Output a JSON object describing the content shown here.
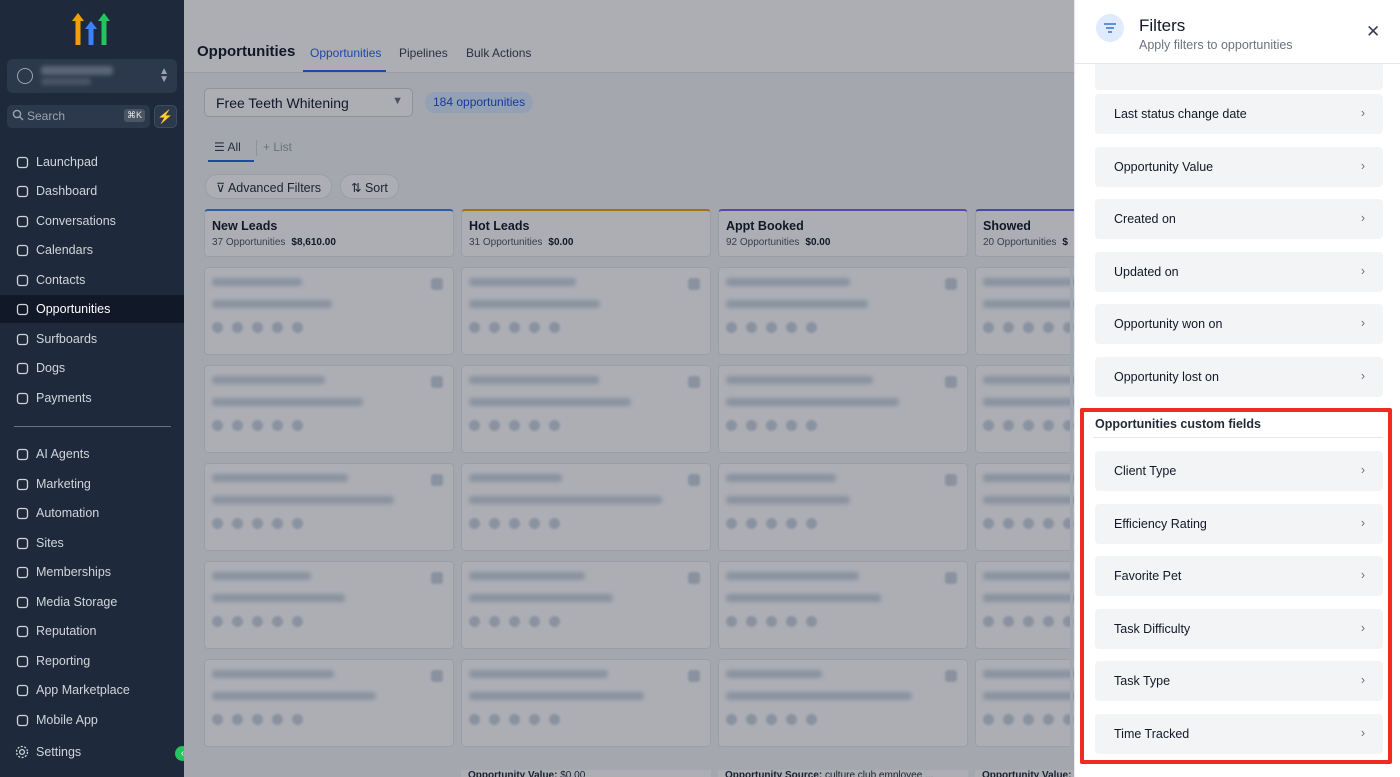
{
  "sidebar": {
    "search_placeholder": "Search",
    "search_shortcut": "⌘K",
    "items": [
      {
        "label": "Launchpad",
        "icon": "rocket-icon"
      },
      {
        "label": "Dashboard",
        "icon": "grid-icon"
      },
      {
        "label": "Conversations",
        "icon": "chat-bubble-icon"
      },
      {
        "label": "Calendars",
        "icon": "calendar-icon"
      },
      {
        "label": "Contacts",
        "icon": "contact-card-icon"
      },
      {
        "label": "Opportunities",
        "icon": "pipeline-icon",
        "active": true
      },
      {
        "label": "Surfboards",
        "icon": "surfboard-icon"
      },
      {
        "label": "Dogs",
        "icon": "paw-icon"
      },
      {
        "label": "Payments",
        "icon": "receipt-icon"
      },
      {
        "label": "AI Agents",
        "icon": "sparkle-icon"
      },
      {
        "label": "Marketing",
        "icon": "send-icon"
      },
      {
        "label": "Automation",
        "icon": "automation-icon"
      },
      {
        "label": "Sites",
        "icon": "sites-icon"
      },
      {
        "label": "Memberships",
        "icon": "membership-icon"
      },
      {
        "label": "Media Storage",
        "icon": "image-icon"
      },
      {
        "label": "Reputation",
        "icon": "star-icon"
      },
      {
        "label": "Reporting",
        "icon": "trend-icon"
      },
      {
        "label": "App Marketplace",
        "icon": "apps-icon"
      },
      {
        "label": "Mobile App",
        "icon": "mobile-icon"
      }
    ],
    "settings_label": "Settings"
  },
  "header": {
    "title": "Opportunities",
    "tabs": [
      "Opportunities",
      "Pipelines",
      "Bulk Actions"
    ],
    "active_tab": "Opportunities"
  },
  "toolbar": {
    "pipeline": "Free Teeth Whitening",
    "count": "184 opportunities",
    "view_all": "All",
    "view_list": "List",
    "advanced_filters": "Advanced Filters",
    "sort": "Sort"
  },
  "columns": [
    {
      "title": "New Leads",
      "count": "37 Opportunities",
      "value": "$8,610.00",
      "color": "#3b82f6"
    },
    {
      "title": "Hot Leads",
      "count": "31 Opportunities",
      "value": "$0.00",
      "color": "#f59e0b"
    },
    {
      "title": "Appt Booked",
      "count": "92 Opportunities",
      "value": "$0.00",
      "color": "#8b5cf6"
    },
    {
      "title": "Showed",
      "count": "20 Opportunities",
      "value": "$",
      "color": "#6366f1"
    }
  ],
  "card_footers": {
    "hot_leads_label": "Opportunity Value:",
    "hot_leads_value": "$0.00",
    "appt_label": "Opportunity Source:",
    "appt_value": "culture club employee ...",
    "showed_label": "Opportunity Value:"
  },
  "filters_panel": {
    "title": "Filters",
    "subtitle": "Apply filters to opportunities",
    "standard_filters": [
      "Last status change date",
      "Opportunity Value",
      "Created on",
      "Updated on",
      "Opportunity won on",
      "Opportunity lost on"
    ],
    "custom_section_title": "Opportunities custom fields",
    "custom_filters": [
      "Client Type",
      "Efficiency Rating",
      "Favorite Pet",
      "Task Difficulty",
      "Task Type",
      "Time Tracked"
    ],
    "highlight_color": "#ef2b1f"
  }
}
